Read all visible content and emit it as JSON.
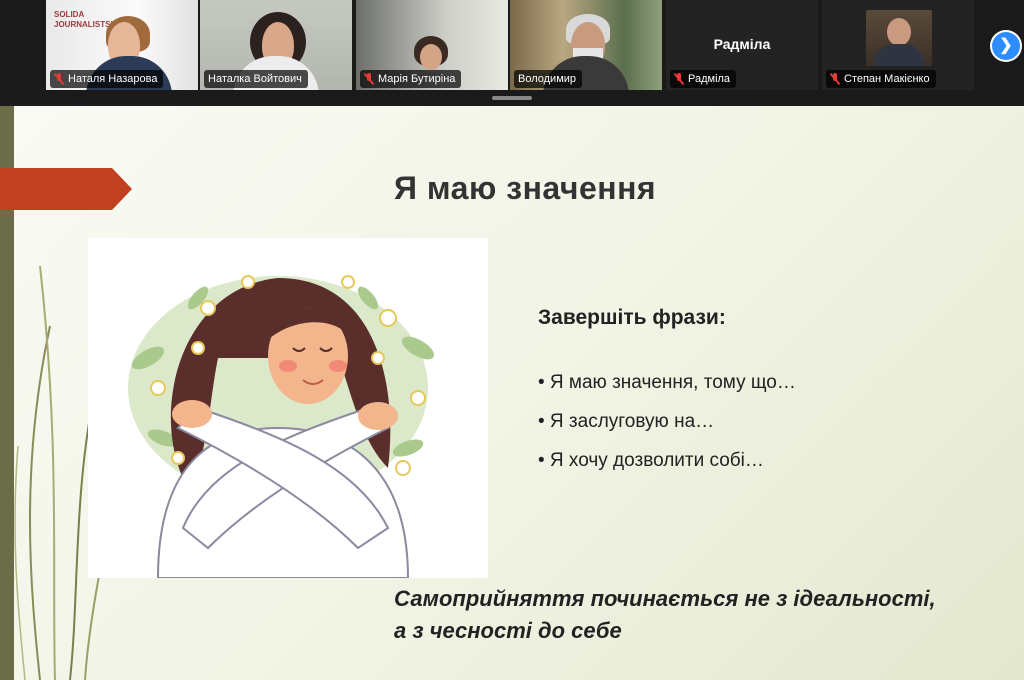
{
  "participants": [
    {
      "name": "Наталя Назарова",
      "muted": true
    },
    {
      "name": "Наталка Войтович",
      "muted": false,
      "active": true
    },
    {
      "name": "Марія Бутиріна",
      "muted": true
    },
    {
      "name": "Володимир",
      "muted": false
    },
    {
      "name": "Радміла",
      "muted": true,
      "video": false
    },
    {
      "name": "Степан Макієнко",
      "muted": true
    }
  ],
  "participant_center_name": "Радміла",
  "next_page_icon": "chevron-right-icon",
  "slide": {
    "title": "Я маю значення",
    "phrases_heading": "Завершіть фрази:",
    "phrases": [
      "• Я маю значення, тому що…",
      "• Я заслуговую на…",
      "• Я хочу дозволити собі…"
    ],
    "quote_line1": "Самоприйняття починається не з ідеальності,",
    "quote_line2": "а з чесності до себе",
    "accent_color": "#c0401f"
  }
}
